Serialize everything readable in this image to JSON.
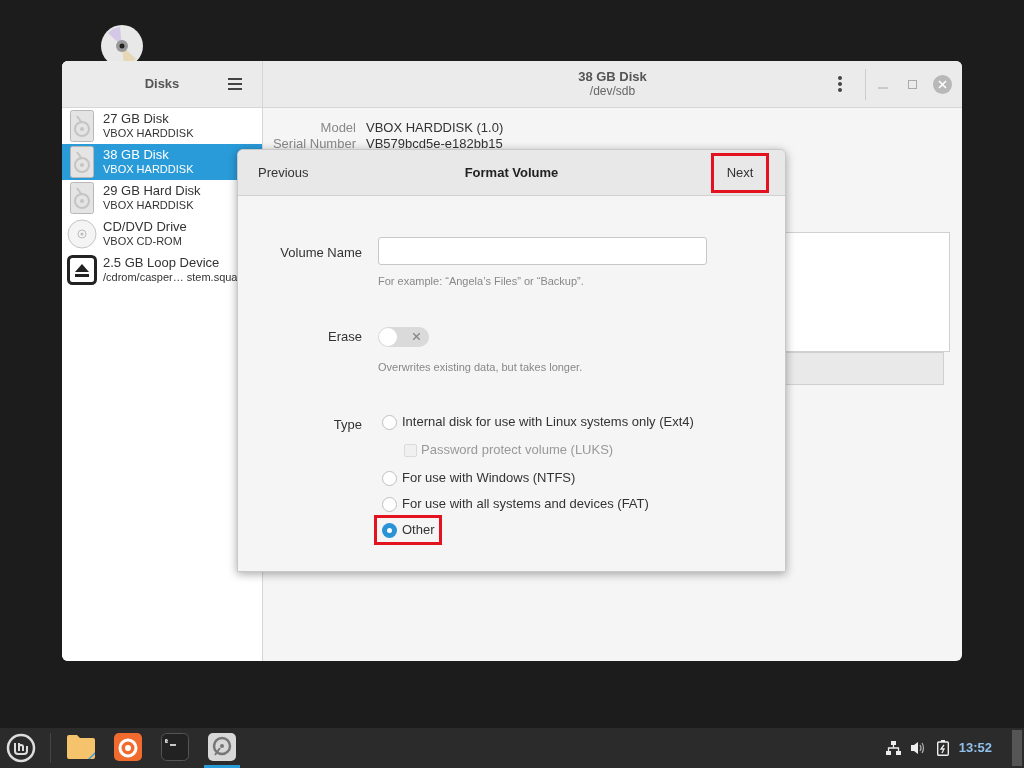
{
  "sidebar": {
    "title": "Disks",
    "items": [
      {
        "kind": "disk",
        "name": "27 GB Disk",
        "detail": "VBOX HARDDISK",
        "selected": false
      },
      {
        "kind": "disk",
        "name": "38 GB Disk",
        "detail": "VBOX HARDDISK",
        "selected": true
      },
      {
        "kind": "disk",
        "name": "29 GB Hard Disk",
        "detail": "VBOX HARDDISK",
        "selected": false
      },
      {
        "kind": "optical",
        "name": "CD/DVD Drive",
        "detail": "VBOX CD-ROM",
        "selected": false
      },
      {
        "kind": "loop",
        "name": "2.5 GB Loop Device",
        "detail": "/cdrom/casper… stem.squa",
        "selected": false
      }
    ]
  },
  "header": {
    "title": "38 GB Disk",
    "subtitle": "/dev/sdb"
  },
  "details": [
    {
      "label": "Model",
      "value": "VBOX HARDDISK (1.0)"
    },
    {
      "label": "Serial Number",
      "value": "VB579bcd5e-e182bb15"
    }
  ],
  "dialog": {
    "title": "Format Volume",
    "previous": {
      "label": "Previous",
      "highlighted": false
    },
    "next": {
      "label": "Next",
      "highlighted": true
    },
    "volume_name": {
      "label": "Volume Name",
      "hint": "For example: “Angela’s Files” or “Backup”."
    },
    "erase": {
      "label": "Erase",
      "on": false,
      "hint": "Overwrites existing data, but takes longer."
    },
    "type": {
      "label": "Type",
      "options": [
        {
          "kind": "radio",
          "label": "Internal disk for use with Linux systems only (Ext4)",
          "selected": false,
          "highlighted": false
        },
        {
          "kind": "checkbox",
          "label": "Password protect volume (LUKS)",
          "checked": false,
          "disabled": true
        },
        {
          "kind": "radio",
          "label": "For use with Windows (NTFS)",
          "selected": false,
          "highlighted": false
        },
        {
          "kind": "radio",
          "label": "For use with all systems and devices (FAT)",
          "selected": false,
          "highlighted": false
        },
        {
          "kind": "radio",
          "label": "Other",
          "selected": true,
          "highlighted": true
        }
      ]
    }
  },
  "taskbar": {
    "apps": [
      {
        "kind": "folder",
        "active": false
      },
      {
        "kind": "browser",
        "active": false
      },
      {
        "kind": "terminal",
        "active": false
      },
      {
        "kind": "disks",
        "active": true
      }
    ],
    "clock": "13:52"
  }
}
